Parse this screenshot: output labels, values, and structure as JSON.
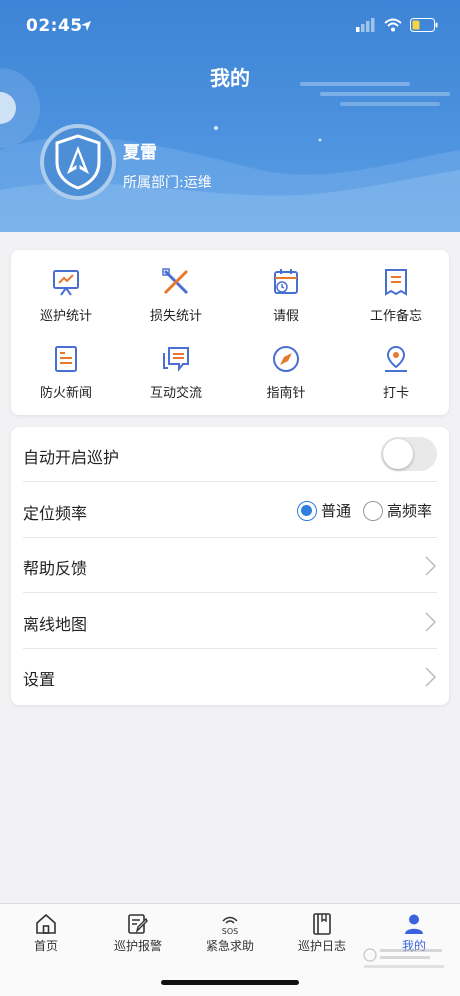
{
  "status_bar": {
    "time": "02:45"
  },
  "header": {
    "title": "我的",
    "user_name": "夏雷",
    "department": "所属部门:运维",
    "avatar_icon": "shield-tree-logo"
  },
  "grid": [
    {
      "label": "巡护统计",
      "icon": "chart-board-icon"
    },
    {
      "label": "损失统计",
      "icon": "cross-tools-icon"
    },
    {
      "label": "请假",
      "icon": "calendar-clock-icon"
    },
    {
      "label": "工作备忘",
      "icon": "memo-icon"
    },
    {
      "label": "防火新闻",
      "icon": "news-icon"
    },
    {
      "label": "互动交流",
      "icon": "chat-icon"
    },
    {
      "label": "指南针",
      "icon": "compass-icon"
    },
    {
      "label": "打卡",
      "icon": "location-checkin-icon"
    }
  ],
  "settings": {
    "auto_patrol": {
      "label": "自动开启巡护",
      "enabled": false
    },
    "location_freq": {
      "label": "定位频率",
      "options": [
        "普通",
        "高频率"
      ],
      "selected": "普通"
    },
    "help": "帮助反馈",
    "offline_map": "离线地图",
    "settings": "设置"
  },
  "tabbar": [
    {
      "label": "首页",
      "icon": "home-icon",
      "active": false
    },
    {
      "label": "巡护报警",
      "icon": "edit-report-icon",
      "active": false
    },
    {
      "label": "紧急求助",
      "icon": "sos-icon",
      "sos_text": "SOS",
      "active": false
    },
    {
      "label": "巡护日志",
      "icon": "book-icon",
      "active": false
    },
    {
      "label": "我的",
      "icon": "user-icon",
      "active": true
    }
  ],
  "colors": {
    "header": "#4189d9",
    "accent": "#2f7fe0",
    "tab_active": "#3b63e0"
  }
}
